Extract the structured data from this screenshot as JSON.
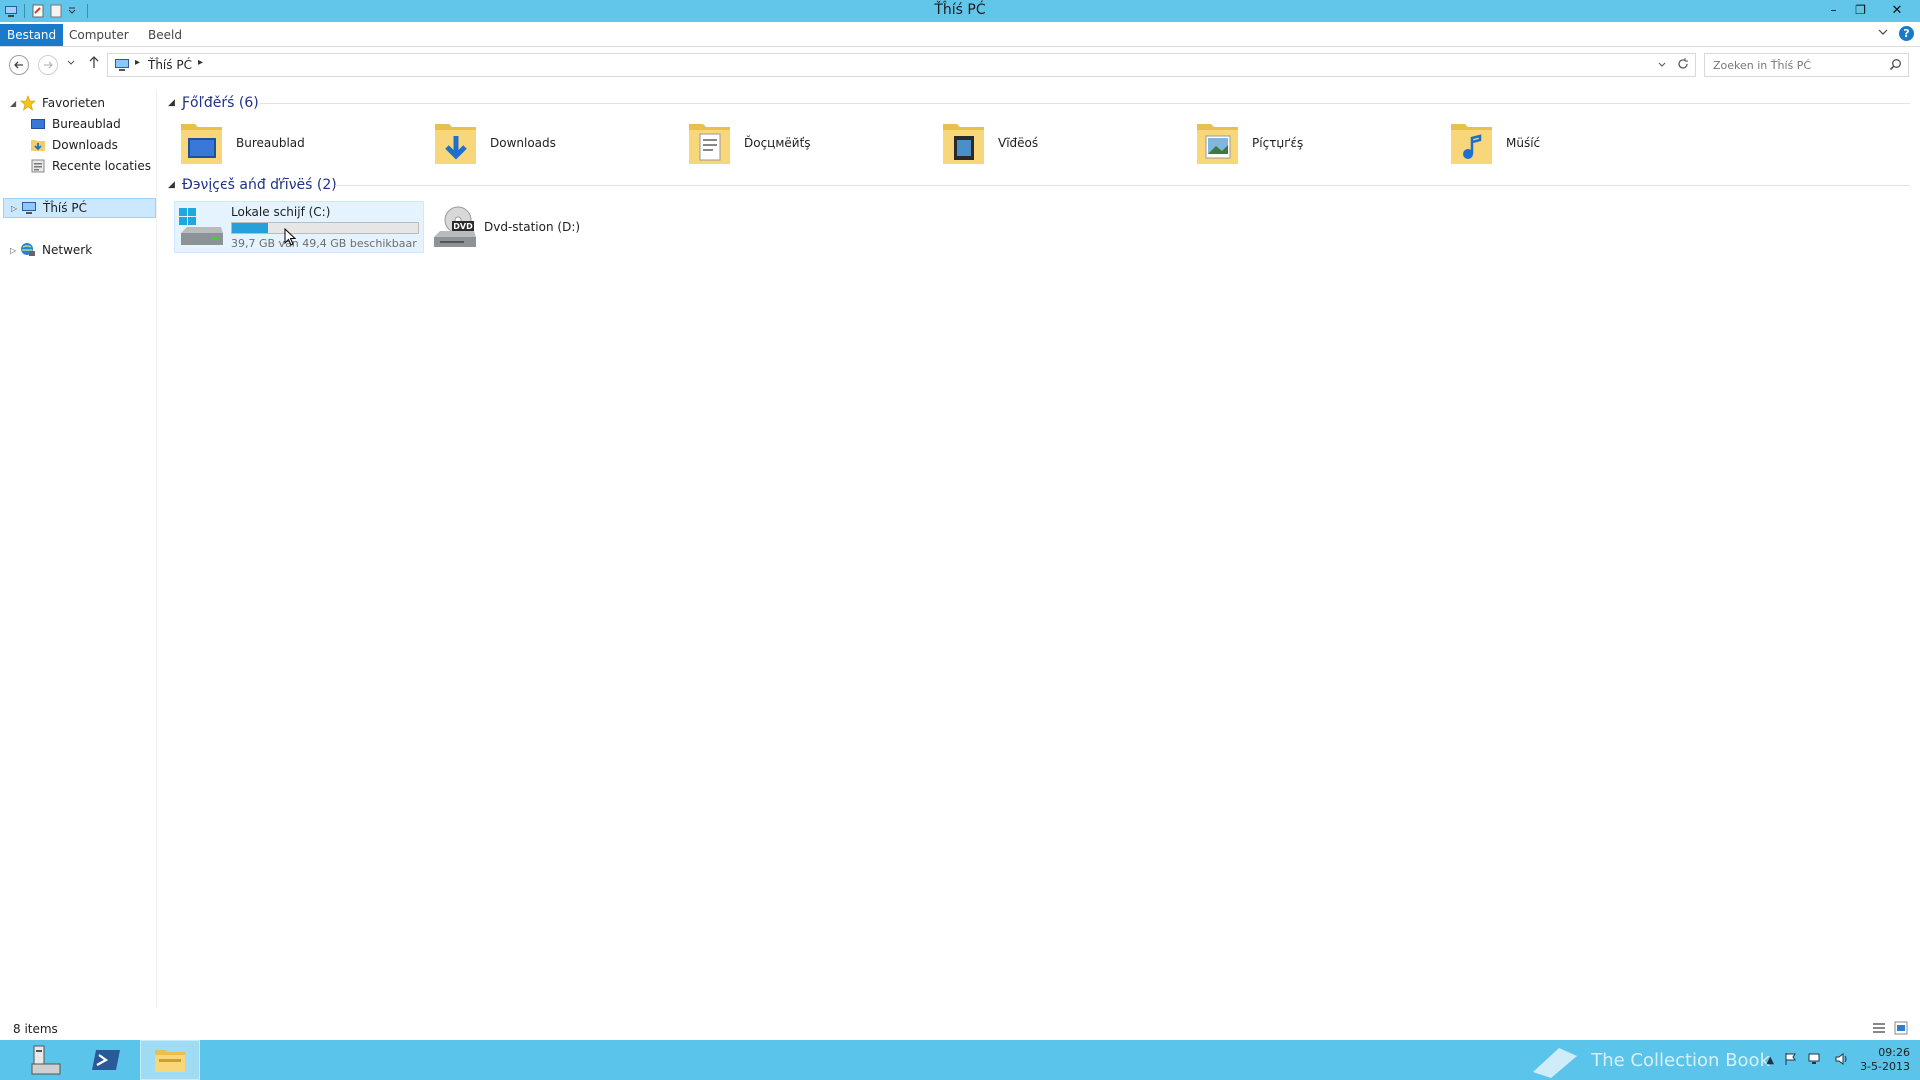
{
  "window": {
    "title": "Ťĥíś РĆ",
    "controls": {
      "minimize": "–",
      "restore": "❐",
      "close": "✕"
    }
  },
  "ribbon": {
    "tabs": [
      {
        "label": "Bestand",
        "active": true
      },
      {
        "label": "Computer",
        "active": false
      },
      {
        "label": "Beeld",
        "active": false
      }
    ],
    "help": "?"
  },
  "address": {
    "location": "Ťĥíś РĆ",
    "search_placeholder": "Zoeken in Ťĥíś РĆ"
  },
  "navpane": {
    "favorites": {
      "label": "Favorieten",
      "items": [
        "Bureaublad",
        "Downloads",
        "Recente locaties"
      ]
    },
    "this_pc": "Ťĥíś РĆ",
    "network": "Netwerk"
  },
  "content": {
    "folders_header": "Ƒőľđěŕś (6)",
    "folders": [
      {
        "label": "Bureaublad",
        "icon": "desktop-folder-icon"
      },
      {
        "label": "Downloads",
        "icon": "downloads-folder-icon"
      },
      {
        "label": "Ďоçцмёйťş",
        "icon": "documents-folder-icon"
      },
      {
        "label": "Vĩđёoś",
        "icon": "videos-folder-icon"
      },
      {
        "label": "Рíçτџґέş",
        "icon": "pictures-folder-icon"
      },
      {
        "label": "Müśíć",
        "icon": "music-folder-icon"
      }
    ],
    "devices_header": "Ðэνįçєš аńđ ďŕīνёś (2)",
    "drives": [
      {
        "name": "Lokale schijf (C:)",
        "free_text": "39,7 GB van 49,4 GB beschikbaar",
        "used_fraction": 0.196,
        "icon": "hard-drive-icon"
      },
      {
        "name": "Dvd-station (D:)",
        "icon": "dvd-drive-icon",
        "dvd_label": "DVD"
      }
    ]
  },
  "statusbar": {
    "count": "8 items"
  },
  "taskbar": {
    "watermark": "The Collection Book",
    "time": "09:26",
    "date": "3-5-2013"
  },
  "colors": {
    "titlebar": "#62c6ea",
    "accent": "#1979ca",
    "taskbar": "#5bc4ea",
    "drive_fill": "#26a0da"
  }
}
